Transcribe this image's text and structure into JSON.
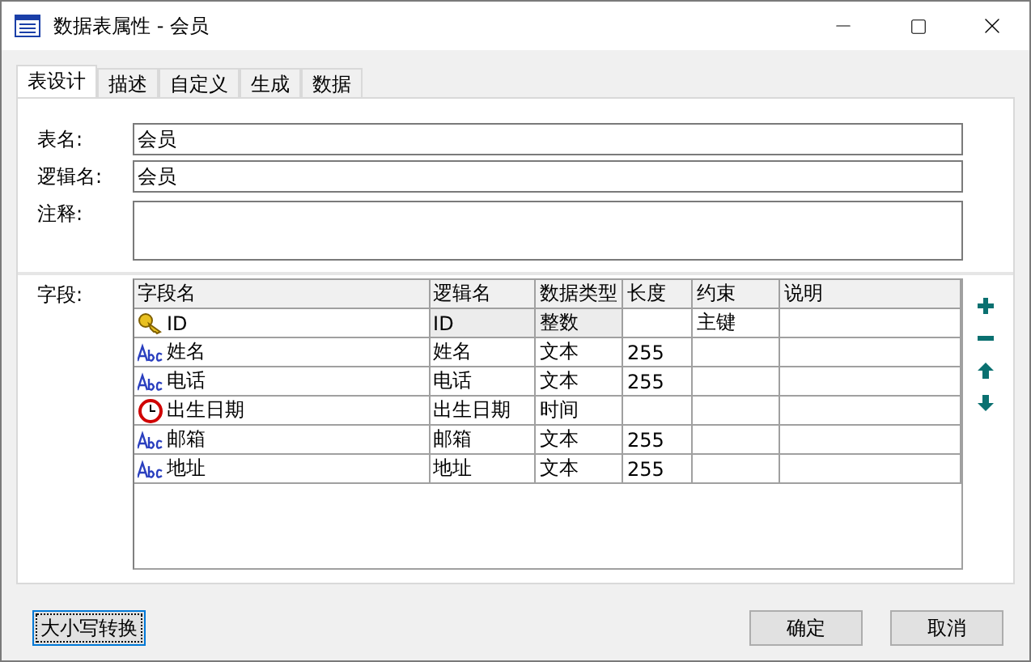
{
  "window": {
    "title": "数据表属性 - 会员"
  },
  "tabs": [
    {
      "label": "表设计",
      "selected": true
    },
    {
      "label": "描述",
      "selected": false
    },
    {
      "label": "自定义",
      "selected": false
    },
    {
      "label": "生成",
      "selected": false
    },
    {
      "label": "数据",
      "selected": false
    }
  ],
  "form": {
    "table_name_label": "表名:",
    "table_name": "会员",
    "logical_name_label": "逻辑名:",
    "logical_name": "会员",
    "comment_label": "注释:",
    "fields_label": "字段:"
  },
  "table": {
    "columns": [
      "字段名",
      "逻辑名",
      "数据类型",
      "长度",
      "约束",
      "说明"
    ],
    "rows": [
      {
        "kind": "key",
        "selected": true,
        "cells": [
          "ID",
          "ID",
          "整数",
          "",
          "主键",
          ""
        ]
      },
      {
        "kind": "text",
        "selected": false,
        "cells": [
          "姓名",
          "姓名",
          "文本",
          "255",
          "",
          ""
        ]
      },
      {
        "kind": "text",
        "selected": false,
        "cells": [
          "电话",
          "电话",
          "文本",
          "255",
          "",
          ""
        ]
      },
      {
        "kind": "time",
        "selected": false,
        "cells": [
          "出生日期",
          "出生日期",
          "时间",
          "",
          "",
          ""
        ]
      },
      {
        "kind": "text",
        "selected": false,
        "cells": [
          "邮箱",
          "邮箱",
          "文本",
          "255",
          "",
          ""
        ]
      },
      {
        "kind": "text",
        "selected": false,
        "cells": [
          "地址",
          "地址",
          "文本",
          "255",
          "",
          ""
        ]
      }
    ]
  },
  "buttons": {
    "case_convert": "大小写转换",
    "ok": "确定",
    "cancel": "取消"
  }
}
